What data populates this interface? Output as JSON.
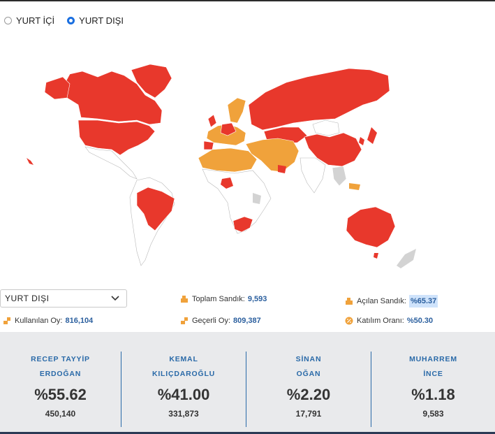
{
  "scope_options": [
    {
      "label": "YURT İÇİ",
      "checked": false
    },
    {
      "label": "YURT DIŞI",
      "checked": true
    }
  ],
  "map_colors": {
    "winner_red": "#e8382c",
    "second_orange": "#f0a23b",
    "no_data_gray": "#d3d3d3",
    "land_white": "#ffffff",
    "border_gray": "#b9b9b9"
  },
  "region_select": {
    "value": "YURT DIŞI"
  },
  "stats": {
    "toplam_sandik": {
      "label": "Toplam Sandık:",
      "value": "9,593"
    },
    "acilan_sandik": {
      "label": "Açılan Sandık:",
      "value": "%65.37"
    },
    "kullanilan_oy": {
      "label": "Kullanılan Oy:",
      "value": "816,104"
    },
    "gecerli_oy": {
      "label": "Geçerli Oy:",
      "value": "809,387"
    },
    "katilim_orani": {
      "label": "Katılım Oranı:",
      "value": "%50.30"
    }
  },
  "candidates": [
    {
      "first": "RECEP TAYYİP",
      "last": "ERDOĞAN",
      "percent": "%55.62",
      "votes": "450,140"
    },
    {
      "first": "KEMAL",
      "last": "KILIÇDAROĞLU",
      "percent": "%41.00",
      "votes": "331,873"
    },
    {
      "first": "SİNAN",
      "last": "OĞAN",
      "percent": "%2.20",
      "votes": "17,791"
    },
    {
      "first": "MUHARREM",
      "last": "İNCE",
      "percent": "%1.18",
      "votes": "9,583"
    }
  ]
}
